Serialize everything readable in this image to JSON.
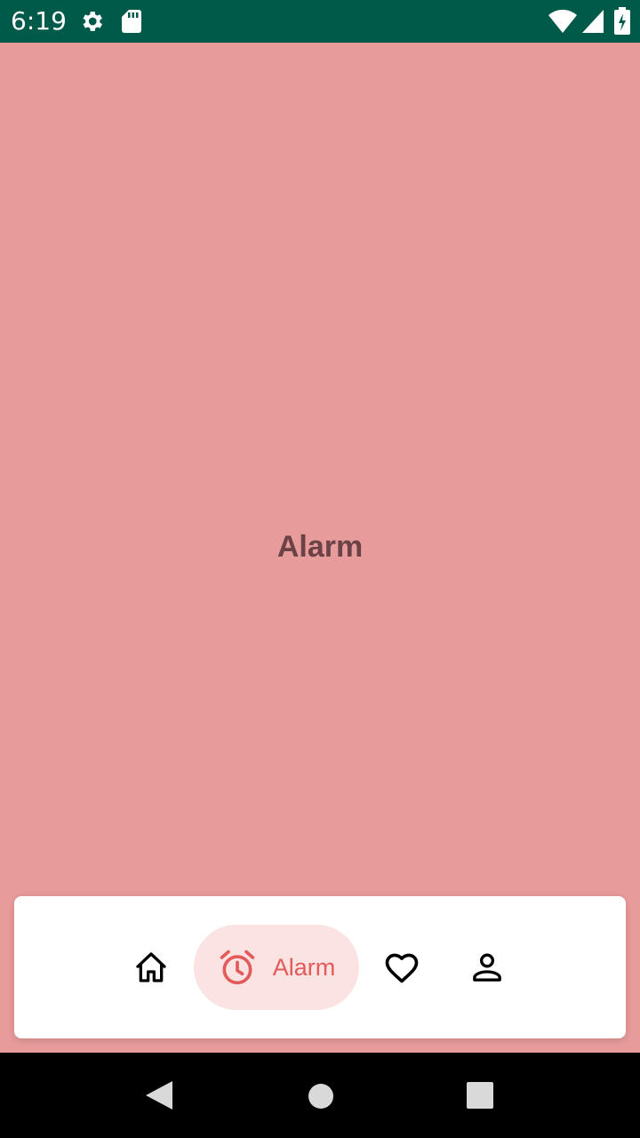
{
  "status_bar": {
    "time": "6:19",
    "icons": [
      "gear-icon",
      "sd-card-icon",
      "wifi-icon",
      "signal-icon",
      "battery-icon"
    ],
    "background": "#005a4a"
  },
  "main": {
    "title": "Alarm",
    "background": "#e89b9b"
  },
  "bottom_nav": {
    "items": [
      {
        "icon": "home-icon",
        "label": "",
        "selected": false
      },
      {
        "icon": "alarm-clock-icon",
        "label": "Alarm",
        "selected": true
      },
      {
        "icon": "heart-icon",
        "label": "",
        "selected": false
      },
      {
        "icon": "profile-icon",
        "label": "",
        "selected": false
      }
    ],
    "accent": "#e35a5a",
    "selected_background": "#fbe3e3"
  },
  "system_nav": {
    "icons": [
      "back-icon",
      "home-circle-icon",
      "recents-icon"
    ]
  }
}
